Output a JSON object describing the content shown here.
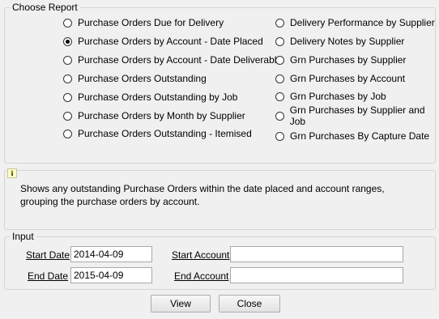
{
  "choose_report": {
    "title": "Choose Report",
    "left_options": [
      {
        "label": "Purchase Orders Due for Delivery",
        "selected": false
      },
      {
        "label": "Purchase Orders by Account - Date Placed",
        "selected": true
      },
      {
        "label": "Purchase Orders by Account - Date Deliverable",
        "selected": false
      },
      {
        "label": "Purchase Orders Outstanding",
        "selected": false
      },
      {
        "label": "Purchase Orders Outstanding by Job",
        "selected": false
      },
      {
        "label": "Purchase Orders by Month by Supplier",
        "selected": false
      },
      {
        "label": "Purchase Orders Outstanding - Itemised",
        "selected": false
      }
    ],
    "right_options": [
      {
        "label": "Delivery Performance by Supplier",
        "selected": false
      },
      {
        "label": "Delivery Notes by Supplier",
        "selected": false
      },
      {
        "label": "Grn Purchases by Supplier",
        "selected": false
      },
      {
        "label": "Grn Purchases by Account",
        "selected": false
      },
      {
        "label": "Grn Purchases by Job",
        "selected": false
      },
      {
        "label": "Grn Purchases by Supplier and Job",
        "selected": false
      },
      {
        "label": "Grn Purchases By Capture Date",
        "selected": false
      }
    ]
  },
  "info": {
    "icon": "info-icon",
    "line1": "Shows any outstanding Purchase Orders within the date placed and account ranges,",
    "line2": "grouping the purchase orders by account."
  },
  "input": {
    "title": "Input",
    "start_date_label": "Start Date",
    "start_date_value": "2014-04-09",
    "end_date_label": "End Date",
    "end_date_value": "2015-04-09",
    "start_account_label": "Start Account",
    "start_account_value": "",
    "end_account_label": "End Account",
    "end_account_value": ""
  },
  "buttons": {
    "view": "View",
    "close": "Close"
  }
}
